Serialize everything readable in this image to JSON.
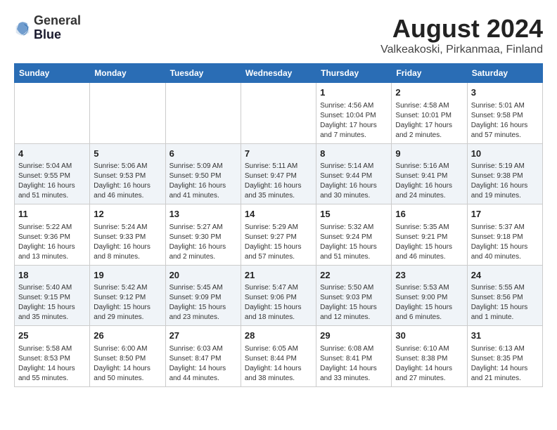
{
  "header": {
    "logo_line1": "General",
    "logo_line2": "Blue",
    "month_year": "August 2024",
    "location": "Valkeakoski, Pirkanmaa, Finland"
  },
  "weekdays": [
    "Sunday",
    "Monday",
    "Tuesday",
    "Wednesday",
    "Thursday",
    "Friday",
    "Saturday"
  ],
  "weeks": [
    [
      {
        "day": "",
        "info": ""
      },
      {
        "day": "",
        "info": ""
      },
      {
        "day": "",
        "info": ""
      },
      {
        "day": "",
        "info": ""
      },
      {
        "day": "1",
        "info": "Sunrise: 4:56 AM\nSunset: 10:04 PM\nDaylight: 17 hours\nand 7 minutes."
      },
      {
        "day": "2",
        "info": "Sunrise: 4:58 AM\nSunset: 10:01 PM\nDaylight: 17 hours\nand 2 minutes."
      },
      {
        "day": "3",
        "info": "Sunrise: 5:01 AM\nSunset: 9:58 PM\nDaylight: 16 hours\nand 57 minutes."
      }
    ],
    [
      {
        "day": "4",
        "info": "Sunrise: 5:04 AM\nSunset: 9:55 PM\nDaylight: 16 hours\nand 51 minutes."
      },
      {
        "day": "5",
        "info": "Sunrise: 5:06 AM\nSunset: 9:53 PM\nDaylight: 16 hours\nand 46 minutes."
      },
      {
        "day": "6",
        "info": "Sunrise: 5:09 AM\nSunset: 9:50 PM\nDaylight: 16 hours\nand 41 minutes."
      },
      {
        "day": "7",
        "info": "Sunrise: 5:11 AM\nSunset: 9:47 PM\nDaylight: 16 hours\nand 35 minutes."
      },
      {
        "day": "8",
        "info": "Sunrise: 5:14 AM\nSunset: 9:44 PM\nDaylight: 16 hours\nand 30 minutes."
      },
      {
        "day": "9",
        "info": "Sunrise: 5:16 AM\nSunset: 9:41 PM\nDaylight: 16 hours\nand 24 minutes."
      },
      {
        "day": "10",
        "info": "Sunrise: 5:19 AM\nSunset: 9:38 PM\nDaylight: 16 hours\nand 19 minutes."
      }
    ],
    [
      {
        "day": "11",
        "info": "Sunrise: 5:22 AM\nSunset: 9:36 PM\nDaylight: 16 hours\nand 13 minutes."
      },
      {
        "day": "12",
        "info": "Sunrise: 5:24 AM\nSunset: 9:33 PM\nDaylight: 16 hours\nand 8 minutes."
      },
      {
        "day": "13",
        "info": "Sunrise: 5:27 AM\nSunset: 9:30 PM\nDaylight: 16 hours\nand 2 minutes."
      },
      {
        "day": "14",
        "info": "Sunrise: 5:29 AM\nSunset: 9:27 PM\nDaylight: 15 hours\nand 57 minutes."
      },
      {
        "day": "15",
        "info": "Sunrise: 5:32 AM\nSunset: 9:24 PM\nDaylight: 15 hours\nand 51 minutes."
      },
      {
        "day": "16",
        "info": "Sunrise: 5:35 AM\nSunset: 9:21 PM\nDaylight: 15 hours\nand 46 minutes."
      },
      {
        "day": "17",
        "info": "Sunrise: 5:37 AM\nSunset: 9:18 PM\nDaylight: 15 hours\nand 40 minutes."
      }
    ],
    [
      {
        "day": "18",
        "info": "Sunrise: 5:40 AM\nSunset: 9:15 PM\nDaylight: 15 hours\nand 35 minutes."
      },
      {
        "day": "19",
        "info": "Sunrise: 5:42 AM\nSunset: 9:12 PM\nDaylight: 15 hours\nand 29 minutes."
      },
      {
        "day": "20",
        "info": "Sunrise: 5:45 AM\nSunset: 9:09 PM\nDaylight: 15 hours\nand 23 minutes."
      },
      {
        "day": "21",
        "info": "Sunrise: 5:47 AM\nSunset: 9:06 PM\nDaylight: 15 hours\nand 18 minutes."
      },
      {
        "day": "22",
        "info": "Sunrise: 5:50 AM\nSunset: 9:03 PM\nDaylight: 15 hours\nand 12 minutes."
      },
      {
        "day": "23",
        "info": "Sunrise: 5:53 AM\nSunset: 9:00 PM\nDaylight: 15 hours\nand 6 minutes."
      },
      {
        "day": "24",
        "info": "Sunrise: 5:55 AM\nSunset: 8:56 PM\nDaylight: 15 hours\nand 1 minute."
      }
    ],
    [
      {
        "day": "25",
        "info": "Sunrise: 5:58 AM\nSunset: 8:53 PM\nDaylight: 14 hours\nand 55 minutes."
      },
      {
        "day": "26",
        "info": "Sunrise: 6:00 AM\nSunset: 8:50 PM\nDaylight: 14 hours\nand 50 minutes."
      },
      {
        "day": "27",
        "info": "Sunrise: 6:03 AM\nSunset: 8:47 PM\nDaylight: 14 hours\nand 44 minutes."
      },
      {
        "day": "28",
        "info": "Sunrise: 6:05 AM\nSunset: 8:44 PM\nDaylight: 14 hours\nand 38 minutes."
      },
      {
        "day": "29",
        "info": "Sunrise: 6:08 AM\nSunset: 8:41 PM\nDaylight: 14 hours\nand 33 minutes."
      },
      {
        "day": "30",
        "info": "Sunrise: 6:10 AM\nSunset: 8:38 PM\nDaylight: 14 hours\nand 27 minutes."
      },
      {
        "day": "31",
        "info": "Sunrise: 6:13 AM\nSunset: 8:35 PM\nDaylight: 14 hours\nand 21 minutes."
      }
    ]
  ]
}
